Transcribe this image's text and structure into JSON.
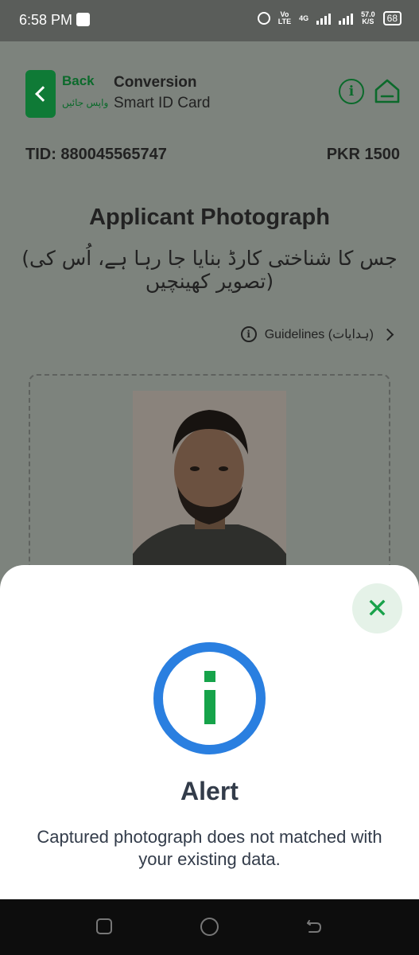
{
  "status_bar": {
    "time": "6:58 PM",
    "network_vo": "Vo",
    "network_lte": "LTE",
    "network_4g": "4G",
    "speed_value": "57.0",
    "speed_unit": "K/S",
    "battery": "68"
  },
  "header": {
    "back_label": "Back",
    "back_label_urdu": "واپس جائیں",
    "title_line1": "Conversion",
    "title_line2": "Smart ID Card",
    "brand_color": "#0b6a2b"
  },
  "info_bar": {
    "tid": "TID: 880045565747",
    "price": "PKR 1500"
  },
  "main": {
    "heading": "Applicant Photograph",
    "subheading_urdu": "(جس کا شناختی کارڈ بنایا جا رہا ہے، اُس کی تصویر کھینچیں)",
    "guidelines_label": "Guidelines (ہدایات)"
  },
  "alert": {
    "title": "Alert",
    "message": "Captured photograph does not matched with your existing data.",
    "close_symbol": "✕",
    "icon_ring_color": "#2a7fe0",
    "icon_color": "#16a34a"
  }
}
